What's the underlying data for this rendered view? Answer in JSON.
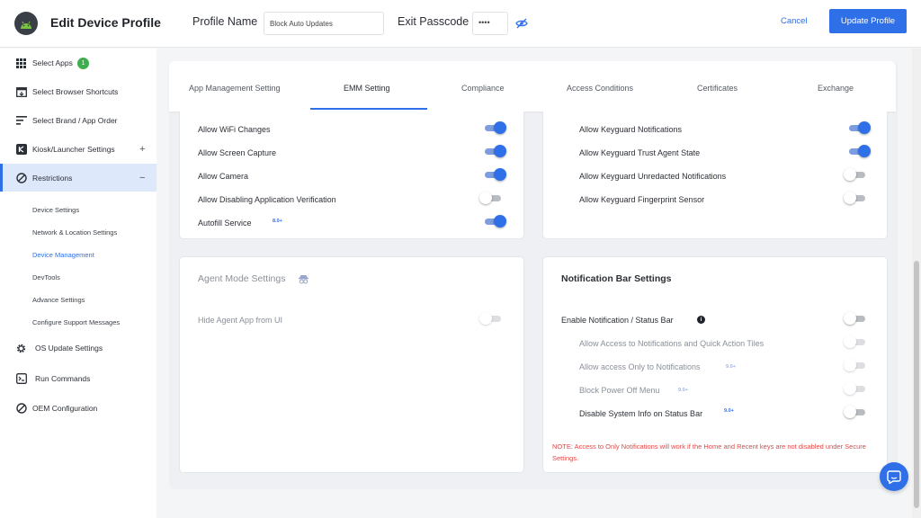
{
  "header": {
    "title": "Edit Device Profile",
    "profile_name_label": "Profile Name",
    "profile_name_value": "Block Auto Updates",
    "exit_passcode_label": "Exit Passcode",
    "exit_passcode_value": "••••",
    "cancel_label": "Cancel",
    "update_label": "Update Profile"
  },
  "sidebar": {
    "items": [
      {
        "label": "Select Apps",
        "badge": "1",
        "icon": "grid-icon"
      },
      {
        "label": "Select Browser Shortcuts",
        "icon": "browser-icon"
      },
      {
        "label": "Select Brand / App Order",
        "icon": "sort-lines-icon"
      },
      {
        "label": "Kiosk/Launcher Settings",
        "icon": "kiosk-icon",
        "toggle": "+"
      },
      {
        "label": "Restrictions",
        "icon": "block-icon",
        "toggle": "−"
      },
      {
        "label": "OS Update Settings",
        "icon": "gear-icon"
      },
      {
        "label": "Run Commands",
        "icon": "terminal-icon"
      },
      {
        "label": "OEM Configuration",
        "icon": "block-icon"
      }
    ],
    "sub_items": [
      "Device Settings",
      "Network & Location Settings",
      "Device Management",
      "DevTools",
      "Advance Settings",
      "Configure Support Messages"
    ],
    "active_sub": "Device Management"
  },
  "tabs": [
    "App Management Setting",
    "EMM Setting",
    "Compliance",
    "Access Conditions",
    "Certificates",
    "Exchange"
  ],
  "active_tab": "EMM Setting",
  "emm_left": [
    {
      "label": "Allow WiFi Changes",
      "on": true
    },
    {
      "label": "Allow Screen Capture",
      "on": true
    },
    {
      "label": "Allow Camera",
      "on": true
    },
    {
      "label": "Allow Disabling Application Verification",
      "on": false
    },
    {
      "label": "Autofill Service",
      "version": "8.0+",
      "on": true
    }
  ],
  "emm_right": [
    {
      "label": "Allow Keyguard Notifications",
      "on": true
    },
    {
      "label": "Allow Keyguard Trust Agent State",
      "on": true
    },
    {
      "label": "Allow Keyguard Unredacted Notifications",
      "on": false
    },
    {
      "label": "Allow Keyguard Fingerprint Sensor",
      "on": false
    }
  ],
  "agent_mode": {
    "title": "Agent Mode Settings",
    "row_label": "Hide Agent App from UI",
    "on": false
  },
  "notification_bar": {
    "title": "Notification Bar Settings",
    "enable_label": "Enable Notification / Status Bar",
    "enable_on": false,
    "rows": [
      {
        "label": "Allow Access to Notifications and Quick Action Tiles",
        "on": false,
        "disabled": true
      },
      {
        "label": "Allow access Only to Notifications",
        "version": "9.0+",
        "on": false,
        "disabled": true
      },
      {
        "label": "Block Power Off Menu",
        "version": "9.0+",
        "on": false,
        "disabled": true
      },
      {
        "label": "Disable System Info on Status Bar",
        "version": "9.0+",
        "on": false,
        "disabled": false
      }
    ],
    "note": "NOTE: Access to Only Notifications will work if the Home and Recent keys are not disabled under Secure Settings."
  },
  "colors": {
    "accent": "#2f6fe8",
    "badge": "#3fae4f",
    "note": "#e04848"
  }
}
